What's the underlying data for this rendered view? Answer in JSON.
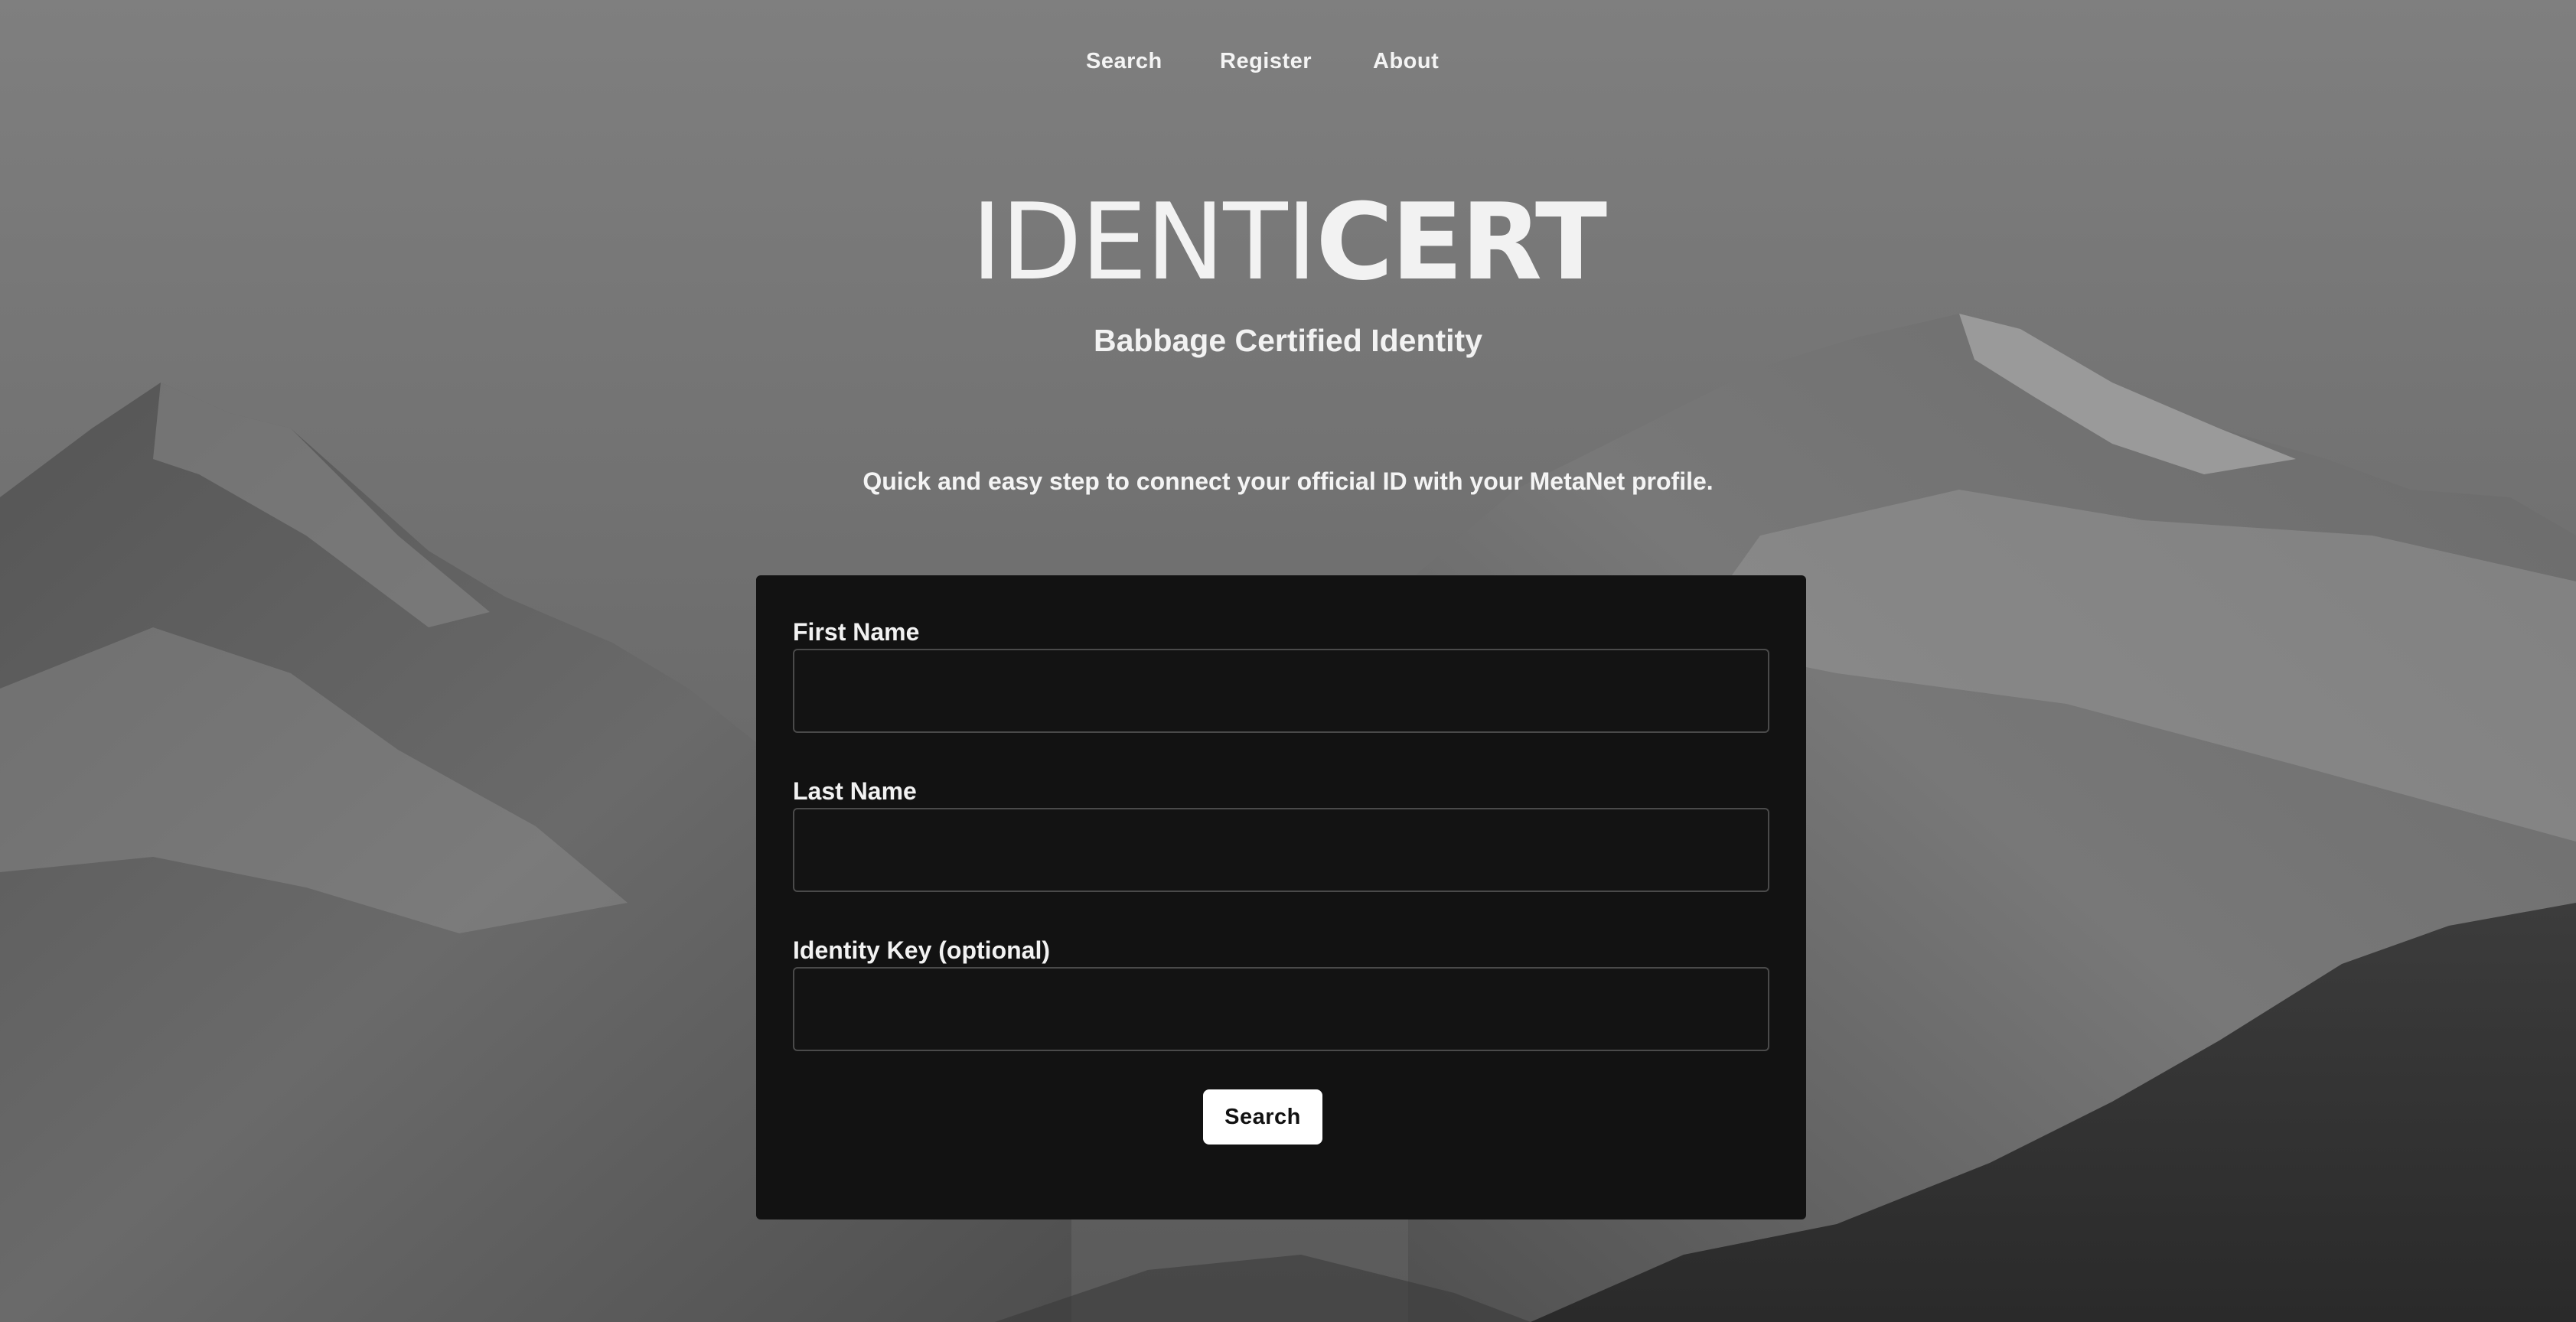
{
  "nav": {
    "items": [
      {
        "label": "Search"
      },
      {
        "label": "Register"
      },
      {
        "label": "About"
      }
    ]
  },
  "hero": {
    "title_light": "IDENTI",
    "title_bold": "CERT",
    "subtitle": "Babbage Certified Identity",
    "tagline": "Quick and easy step to connect your official ID with your MetaNet profile."
  },
  "form": {
    "first_name": {
      "label": "First Name",
      "value": "",
      "placeholder": ""
    },
    "last_name": {
      "label": "Last Name",
      "value": "",
      "placeholder": ""
    },
    "identity_key": {
      "label": "Identity Key (optional)",
      "value": "",
      "placeholder": ""
    },
    "submit_label": "Search"
  },
  "colors": {
    "card_background": "#121212",
    "text": "#f2f2f2",
    "button_background": "#ffffff",
    "button_text": "#111111"
  }
}
